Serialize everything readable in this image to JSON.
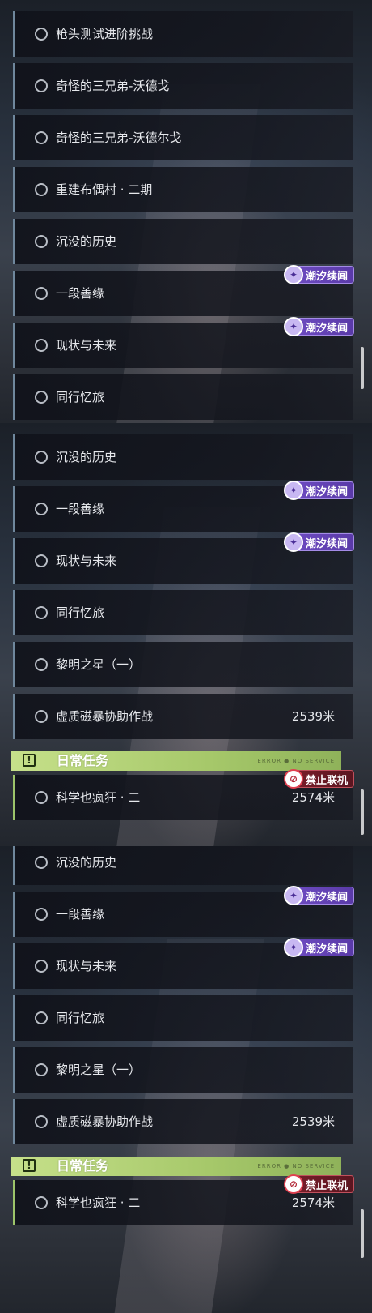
{
  "panel1": {
    "rows": [
      {
        "label": "枪头测试进阶挑战"
      },
      {
        "label": "奇怪的三兄弟-沃德戈"
      },
      {
        "label": "奇怪的三兄弟-沃德尔戈"
      },
      {
        "label": "重建布偶村 · 二期"
      },
      {
        "label": "沉没的历史"
      },
      {
        "label": "一段善缘"
      },
      {
        "label": "现状与未来"
      },
      {
        "label": "同行忆旅"
      }
    ]
  },
  "panel2": {
    "rows": [
      {
        "label": "沉没的历史"
      },
      {
        "label": "一段善缘"
      },
      {
        "label": "现状与未来"
      },
      {
        "label": "同行忆旅"
      },
      {
        "label": "黎明之星（一）"
      },
      {
        "label": "虚质磁暴协助作战",
        "distance": "2539米"
      }
    ],
    "daily_header": "日常任务",
    "daily_mark": "ERROR ● NO SERVICE",
    "daily_row": {
      "label": "科学也疯狂 · 二",
      "distance": "2574米"
    }
  },
  "panel3": {
    "rows": [
      {
        "label": "沉没的历史"
      },
      {
        "label": "一段善缘"
      },
      {
        "label": "现状与未来"
      },
      {
        "label": "同行忆旅"
      },
      {
        "label": "黎明之星（一）"
      },
      {
        "label": "虚质磁暴协助作战",
        "distance": "2539米"
      }
    ],
    "daily_header": "日常任务",
    "daily_mark": "ERROR ● NO SERVICE",
    "daily_row": {
      "label": "科学也疯狂 · 二",
      "distance": "2574米"
    }
  },
  "badges": {
    "tide": "潮汐续闻",
    "no_online": "禁止联机",
    "tide_icon": "sparkle-icon",
    "no_online_icon": "globe-forbidden-icon"
  },
  "colors": {
    "accent_purple": "#6e4cc2",
    "daily_green": "#a6c86a",
    "ban_red": "#7a1e2a"
  }
}
